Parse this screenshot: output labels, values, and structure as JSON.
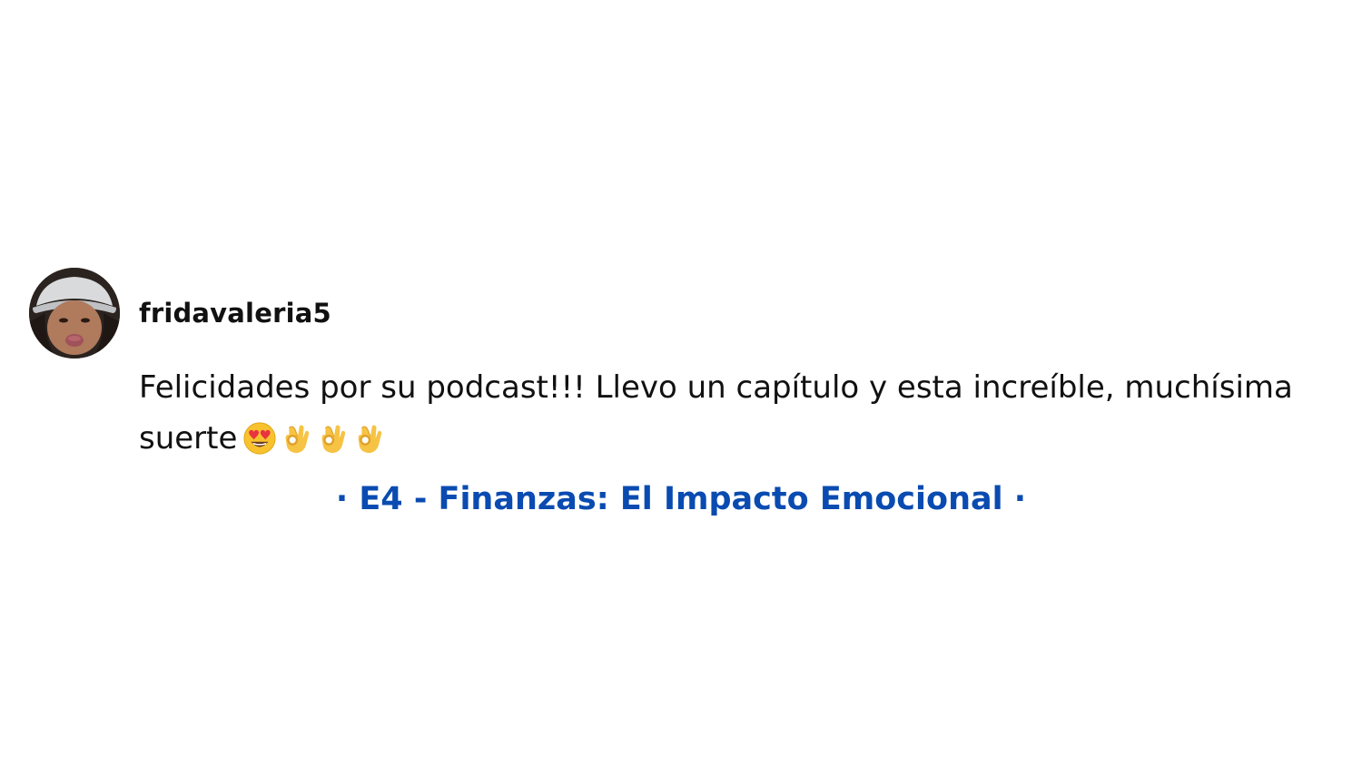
{
  "comment": {
    "username": "fridavaleria5",
    "text": "Felicidades por su podcast!!! Llevo un capítulo y esta increíble, muchísima suerte",
    "emojis": [
      "heart-eyes-face",
      "ok-hand",
      "ok-hand",
      "ok-hand"
    ]
  },
  "episode": {
    "title": "· E4 - Finanzas: El Impacto Emocional ·"
  },
  "colors": {
    "link": "#0a4bb1",
    "text": "#111111",
    "background": "#ffffff"
  }
}
